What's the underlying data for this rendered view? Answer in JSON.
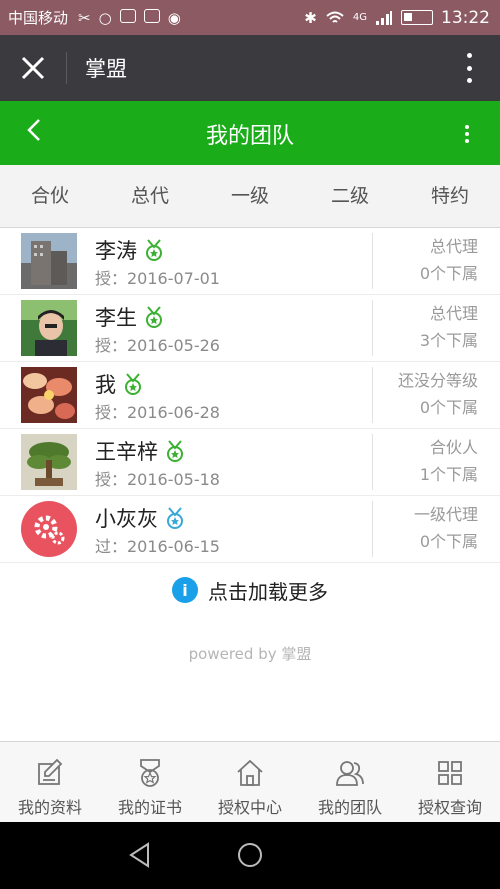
{
  "status_bar": {
    "carrier": "中国移动",
    "network": "4G",
    "time": "13:22"
  },
  "wechat_bar": {
    "title": "掌盟"
  },
  "header": {
    "title": "我的团队"
  },
  "tabs": [
    "合伙",
    "总代",
    "一级",
    "二级",
    "特约"
  ],
  "members": [
    {
      "name": "李涛",
      "date": "授：2016-07-01",
      "level": "总代理",
      "subordinates": "0个下属",
      "medal_color": "#3cb034"
    },
    {
      "name": "李生",
      "date": "授：2016-05-26",
      "level": "总代理",
      "subordinates": "3个下属",
      "medal_color": "#3cb034"
    },
    {
      "name": "我",
      "date": "授：2016-06-28",
      "level": "还没分等级",
      "subordinates": "0个下属",
      "medal_color": "#3cb034"
    },
    {
      "name": "王辛梓",
      "date": "授：2016-05-18",
      "level": "合伙人",
      "subordinates": "1个下属",
      "medal_color": "#3cb034"
    },
    {
      "name": "小灰灰",
      "date": "过：2016-06-15",
      "level": "一级代理",
      "subordinates": "0个下属",
      "medal_color": "#39a8d6"
    }
  ],
  "load_more": "点击加载更多",
  "powered_by": "powered by 掌盟",
  "bottom_nav": [
    "我的资料",
    "我的证书",
    "授权中心",
    "我的团队",
    "授权查询"
  ],
  "colors": {
    "header_green": "#1aad19",
    "wechat_bar": "#3b3a3f",
    "info_blue": "#19a0e8"
  }
}
